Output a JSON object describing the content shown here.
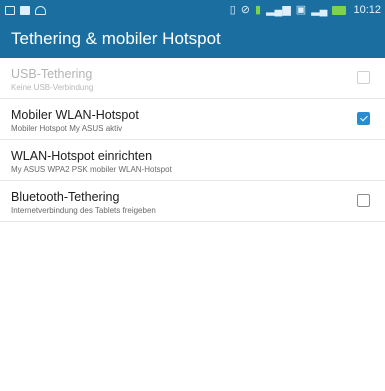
{
  "statusbar": {
    "left_icons": [
      "calendar-icon",
      "message-icon",
      "wifi-icon"
    ],
    "right_icons": [
      "vibrate-icon",
      "no-sim-icon",
      "sd-card-icon",
      "signal-icon",
      "sim-icon",
      "signal-h-icon",
      "battery-charging-icon"
    ],
    "time": "10:12"
  },
  "header": {
    "title": "Tethering & mobiler Hotspot"
  },
  "settings": [
    {
      "title": "USB-Tethering",
      "subtitle": "Keine USB-Verbindung",
      "checked": false,
      "enabled": false
    },
    {
      "title": "Mobiler WLAN-Hotspot",
      "subtitle": "Mobiler Hotspot My ASUS aktiv",
      "checked": true,
      "enabled": true
    },
    {
      "title": "WLAN-Hotspot einrichten",
      "subtitle": "My ASUS WPA2 PSK mobiler WLAN-Hotspot",
      "enabled": true
    },
    {
      "title": "Bluetooth-Tethering",
      "subtitle": "Internetverbindung des Tablets freigeben",
      "checked": false,
      "enabled": true
    }
  ],
  "colors": {
    "accent": "#1a6fa0",
    "checkbox_checked": "#2a8bd3"
  }
}
